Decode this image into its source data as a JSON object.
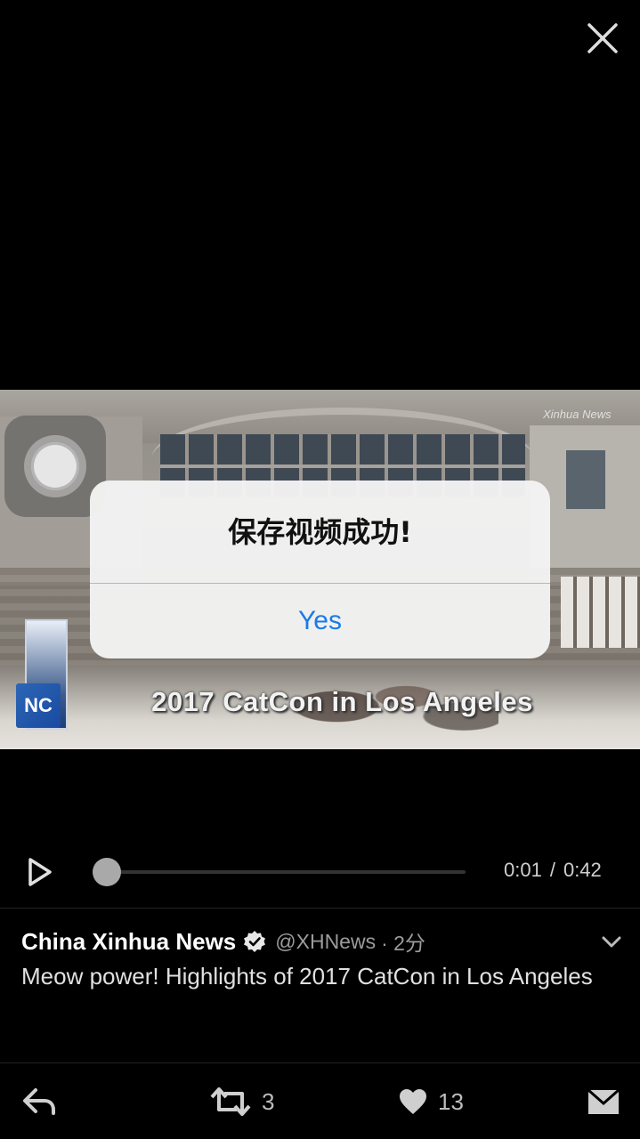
{
  "alert": {
    "title": "保存视频成功!",
    "button_label": "Yes"
  },
  "video": {
    "caption": "2017 CatCon in Los Angeles",
    "watermark": "Xinhua News",
    "logo_text": "NC"
  },
  "player": {
    "current_time": "0:01",
    "separator": "/",
    "total_time": "0:42",
    "progress": 0.02
  },
  "tweet": {
    "author": "China Xinhua News",
    "handle": "@XHNews",
    "time": "· 2分",
    "text": "Meow power! Highlights of 2017 CatCon in Los Angeles"
  },
  "actions": {
    "retweet_count": "3",
    "like_count": "13"
  },
  "icons": {
    "close": "close-icon",
    "play": "play-icon",
    "verified": "verified-badge-icon",
    "more": "chevron-down-icon",
    "reply": "reply-icon",
    "retweet": "retweet-icon",
    "like": "heart-icon",
    "message": "envelope-icon"
  },
  "colors": {
    "background": "#000000",
    "alert_button": "#1a7ae6",
    "alert_background": "#f3f3f3",
    "muted_text": "#9b9b9b"
  }
}
